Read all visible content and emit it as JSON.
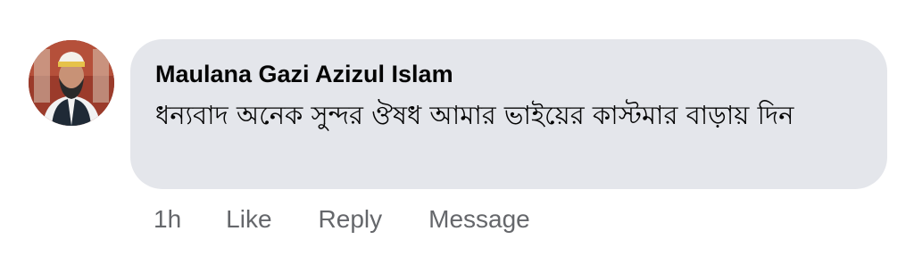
{
  "comment": {
    "author": "Maulana Gazi Azizul Islam",
    "text": "ধন্যবাদ অনেক সুন্দর ঔষধ আমার ভাইয়ের কাস্টমার বাড়ায় দিন",
    "avatar_icon": "profile-photo"
  },
  "actions": {
    "time": "1h",
    "like": "Like",
    "reply": "Reply",
    "message": "Message"
  },
  "colors": {
    "bubble": "#e4e6eb",
    "text": "#050505",
    "secondary": "#65676b"
  }
}
